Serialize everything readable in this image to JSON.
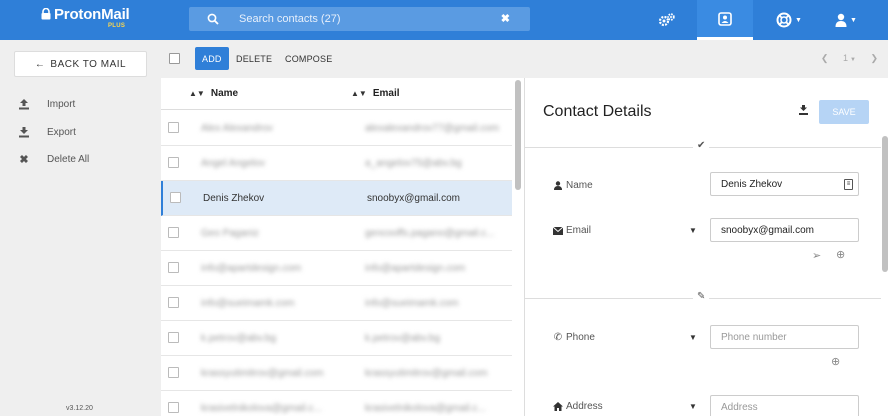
{
  "app": {
    "logo": "ProtonMail",
    "plan": "PLUS"
  },
  "search": {
    "placeholder": "Search contacts (27)"
  },
  "sidebar": {
    "back_label": "BACK TO MAIL",
    "items": [
      {
        "label": "Import",
        "icon": "upload-icon"
      },
      {
        "label": "Export",
        "icon": "download-icon"
      },
      {
        "label": "Delete All",
        "icon": "close-icon"
      }
    ],
    "version": "v3.12.20"
  },
  "toolbar": {
    "add_label": "ADD",
    "delete_label": "DELETE",
    "compose_label": "COMPOSE",
    "page": "1"
  },
  "list": {
    "columns": {
      "name": "Name",
      "email": "Email"
    },
    "rows": [
      {
        "name": "Alex Alexandrov",
        "email": "alexalexandrov77@gmail.com",
        "blurred": true,
        "selected": false
      },
      {
        "name": "Angel Angelov",
        "email": "a_angelov75@abv.bg",
        "blurred": true,
        "selected": false
      },
      {
        "name": "Denis Zhekov",
        "email": "snoobyx@gmail.com",
        "blurred": false,
        "selected": true
      },
      {
        "name": "Geo Paganiz",
        "email": "gencooffs.pagano@gmail.c...",
        "blurred": true,
        "selected": false
      },
      {
        "name": "info@apartdesign.com",
        "email": "info@apartdesign.com",
        "blurred": true,
        "selected": false
      },
      {
        "name": "info@sueimamk.com",
        "email": "info@sueimamk.com",
        "blurred": true,
        "selected": false
      },
      {
        "name": "k.petrov@abv.bg",
        "email": "k.petrov@abv.bg",
        "blurred": true,
        "selected": false
      },
      {
        "name": "krassyutimitrov@gmail.com",
        "email": "krassyutimitrov@gmail.com",
        "blurred": true,
        "selected": false
      },
      {
        "name": "krasivelnikolova@gmail.c...",
        "email": "krasivelnikolova@gmail.c...",
        "blurred": true,
        "selected": false
      }
    ]
  },
  "details": {
    "title": "Contact Details",
    "save_label": "SAVE",
    "name_label": "Name",
    "name_value": "Denis Zhekov",
    "email_label": "Email",
    "email_value": "snoobyx@gmail.com",
    "phone_label": "Phone",
    "phone_placeholder": "Phone number",
    "address_label": "Address",
    "address_placeholder": "Address"
  },
  "colors": {
    "brand": "#2f7fd8",
    "selected_row": "#deeaf7",
    "sidebar_bg": "#efefef",
    "plan_badge": "#ffd84a"
  }
}
